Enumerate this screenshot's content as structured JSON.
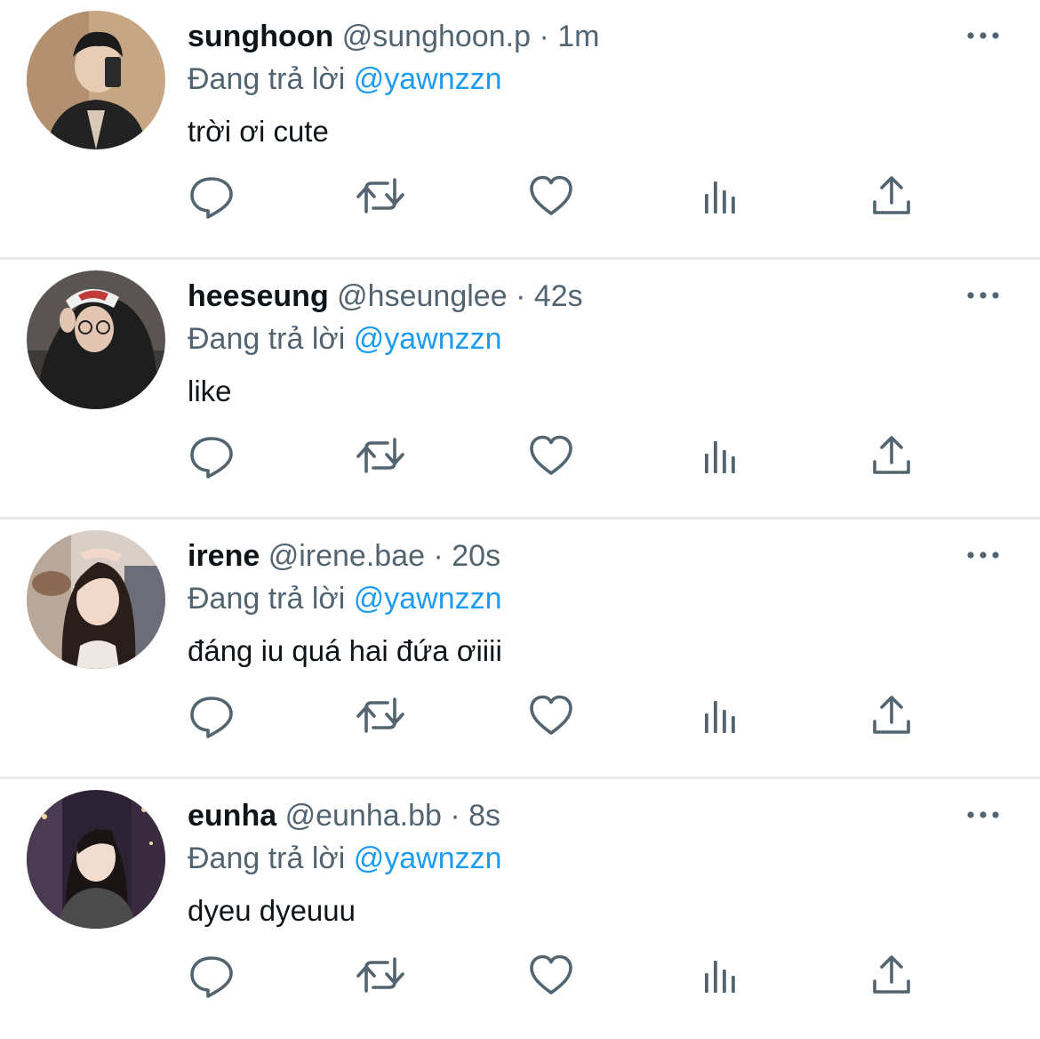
{
  "colors": {
    "text": "#0f1419",
    "secondary": "#536471",
    "accent": "#1d9bf0",
    "divider": "#e6e9eb",
    "icon": "#536471"
  },
  "icons": {
    "reply": "reply-icon",
    "retweet": "retweet-icon",
    "like": "heart-icon",
    "views": "bar-chart-icon",
    "share": "share-icon",
    "more": "more-icon"
  },
  "tweets": [
    {
      "name": "sunghoon",
      "handle": "@sunghoon.p",
      "separator": "·",
      "time": "1m",
      "reply_prefix": "Đang trả lời",
      "reply_to": "@yawnzzn",
      "text": "trời ơi cute"
    },
    {
      "name": "heeseung",
      "handle": "@hseunglee",
      "separator": "·",
      "time": "42s",
      "reply_prefix": "Đang trả lời",
      "reply_to": "@yawnzzn",
      "text": "like"
    },
    {
      "name": "irene",
      "handle": "@irene.bae",
      "separator": "·",
      "time": "20s",
      "reply_prefix": "Đang trả lời",
      "reply_to": "@yawnzzn",
      "text": "đáng iu quá hai đứa ơiiii"
    },
    {
      "name": "eunha",
      "handle": "@eunha.bb",
      "separator": "·",
      "time": "8s",
      "reply_prefix": "Đang trả lời",
      "reply_to": "@yawnzzn",
      "text": "dyeu dyeuuu"
    }
  ]
}
